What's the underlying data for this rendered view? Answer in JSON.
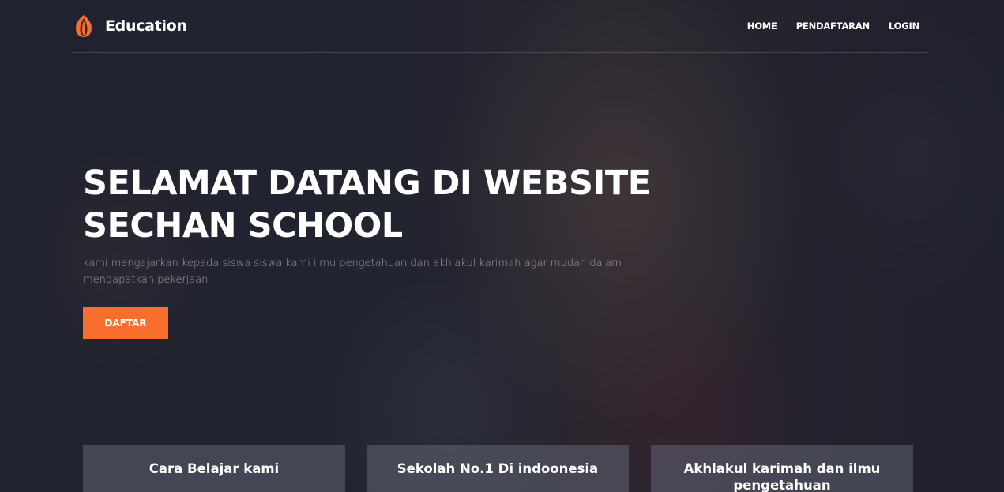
{
  "brand": {
    "name": "Education",
    "logo_icon": "flame-logo-icon",
    "accent_color": "#f86f2d"
  },
  "nav": {
    "items": [
      {
        "label": "HOME"
      },
      {
        "label": "PENDAFTARAN"
      },
      {
        "label": "LOGIN"
      }
    ]
  },
  "hero": {
    "title_line1": "SELAMAT DATANG DI WEBSITE",
    "title_line2": "SECHAN SCHOOL",
    "subtitle": "kami mengajarkan kepada siswa siswa kami ilmu pengetahuan dan akhlakul karimah agar mudah dalam mendapatkan pekerjaan",
    "cta_label": "DAFTAR"
  },
  "features": [
    {
      "title": "Cara Belajar kami"
    },
    {
      "title": "Sekolah No.1 Di indoonesia"
    },
    {
      "title": "Akhlakul karimah dan ilmu pengetahuan"
    }
  ]
}
